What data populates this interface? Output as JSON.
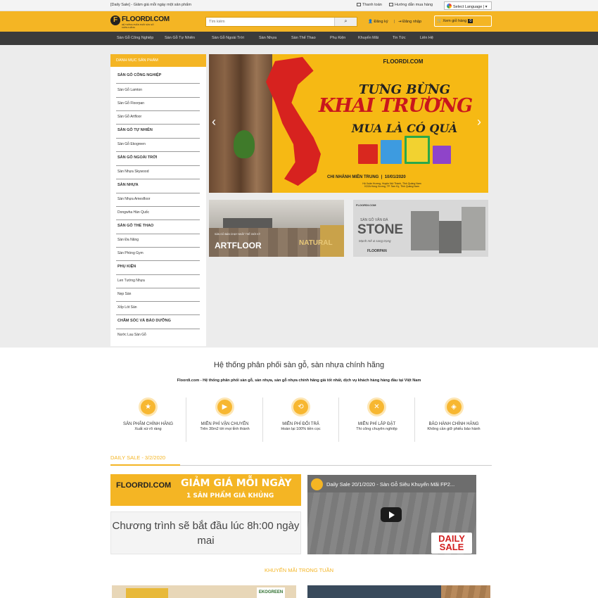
{
  "topbar": {
    "promo": "[Daily Sale] - Giảm giá mỗi ngày một sản phẩm",
    "payment": "Thanh toán",
    "guide": "Hướng dẫn mua hàng",
    "language": "Select Language"
  },
  "header": {
    "logo": "FLOORDI.COM",
    "logo_sub": "HỆ THỐNG PHÂN PHỐI SÀN GỖ CHÍNH HÃNG",
    "search_placeholder": "Tìm kiếm",
    "register": "Đăng ký",
    "login": "Đăng nhập",
    "cart": "Xem giỏ hàng",
    "cart_count": "0"
  },
  "nav": [
    "Sàn Gỗ Công Nghiệp",
    "Sàn Gỗ Tự Nhiên",
    "Sàn Gỗ Ngoài Trời",
    "Sàn Nhựa",
    "Sàn Thể Thao",
    "Phụ Kiện",
    "Khuyến Mãi",
    "Tin Tức",
    "Liên Hệ"
  ],
  "sidebar": {
    "title": "DANH MỤC SẢN PHẨM",
    "items": [
      {
        "label": "SÀN GỖ CÔNG NGHIỆP",
        "cat": true
      },
      {
        "label": "Sàn Gỗ Lamton",
        "cat": false
      },
      {
        "label": "Sàn Gỗ Floorpan",
        "cat": false
      },
      {
        "label": "Sàn Gỗ Artfloor",
        "cat": false
      },
      {
        "label": "SÀN GỖ TỰ NHIÊN",
        "cat": true
      },
      {
        "label": "Sàn Gỗ Ekogreen",
        "cat": false
      },
      {
        "label": "SÀN GỖ NGOÀI TRỜI",
        "cat": true
      },
      {
        "label": "Sàn Nhựa Skywood",
        "cat": false
      },
      {
        "label": "SÀN NHỰA",
        "cat": true
      },
      {
        "label": "Sàn Nhựa Amesfloor",
        "cat": false
      },
      {
        "label": "Dongwha Hàn Quốc",
        "cat": false
      },
      {
        "label": "SÀN GỖ THỂ THAO",
        "cat": true
      },
      {
        "label": "Sàn Đa Năng",
        "cat": false
      },
      {
        "label": "Sàn Phòng Gym",
        "cat": false
      },
      {
        "label": "PHỤ KIỆN",
        "cat": true
      },
      {
        "label": "Len Tường Nhựa",
        "cat": false
      },
      {
        "label": "Nẹp Sàn",
        "cat": false
      },
      {
        "label": "Xốp Lót Sàn",
        "cat": false
      },
      {
        "label": "CHĂM SÓC VÀ BẢO DƯỠNG",
        "cat": true
      },
      {
        "label": "Nước Lau Sàn Gỗ",
        "cat": false
      }
    ]
  },
  "banner": {
    "logo": "FLOORDI.COM",
    "line1": "TƯNG BỪNG",
    "line2": "KHAI TRƯƠNG",
    "line3": "MUA LÀ CÓ QUÀ",
    "branch": "CHI NHÁNH MIỀN TRUNG",
    "date": "10/01/2020",
    "addr1": "Hộ Xuân Hương, Huyện Núi Thành, Tỉnh Quảng Nam",
    "addr2": "K22A Hùng Vương, TP. Tam Kỳ, Tỉnh Quảng Nam"
  },
  "promo_left": {
    "small": "SÀN GỖ BÁN CHẠY NHẤT THẾ GIỚI KỲ",
    "brand": "ARTFLOOR",
    "series": "NATURAL"
  },
  "promo_right": {
    "top": "SÀN GỖ VÂN ĐÁ",
    "brand": "STONE",
    "slogan": "Mạnh mẽ & sang trọng",
    "maker": "FLOORPAN"
  },
  "intro": {
    "title": "Hệ thống phân phối sàn gỗ, sàn nhựa chính hãng",
    "subtitle": "Floordi.com - Hệ thống phân phối sàn gỗ, sàn nhựa, sàn gỗ nhựa chính hãng giá tốt nhất, dịch vụ khách hàng hàng đầu tại Việt Nam"
  },
  "features": [
    {
      "title": "SẢN PHẨM CHÍNH HÃNG",
      "desc": "Xuất xứ rõ ràng",
      "icon": "star-badge-icon"
    },
    {
      "title": "MIỄN PHÍ VẬN CHUYỂN",
      "desc": "Trên 30m2 tới mọi tỉnh thành",
      "icon": "truck-icon"
    },
    {
      "title": "MIỄN PHÍ ĐỔI TRẢ",
      "desc": "Hoàn lại 100% tiền cọc",
      "icon": "refresh-icon"
    },
    {
      "title": "MIỄN PHÍ LẮP ĐẶT",
      "desc": "Thi công chuyên nghiệp",
      "icon": "tools-icon"
    },
    {
      "title": "BẢO HÀNH CHÍNH HÃNG",
      "desc": "Không cần giữ phiếu bảo hành",
      "icon": "shield-icon"
    }
  ],
  "daily": {
    "label": "DAILY SALE - 3/2/2020",
    "banner_line1": "GIẢM GIÁ MỖI NGÀY",
    "banner_line2": "1 SẢN PHẨM GIÁ KHỦNG",
    "countdown": "Chương trình sẽ bắt đầu lúc 8h:00 ngày mai",
    "video_title": "Daily Sale 20/1/2020 - Sàn Gỗ Siêu Khuyến Mãi FP2...",
    "video_badge": "DAILY SALE"
  },
  "weekly": {
    "title": "KHUYẾN MÃI TRONG TUẦN",
    "tag": "EKOGREEN"
  },
  "colors": {
    "accent": "#f4b524",
    "nav": "#3b3b3b",
    "banner_red": "#c9161d"
  }
}
